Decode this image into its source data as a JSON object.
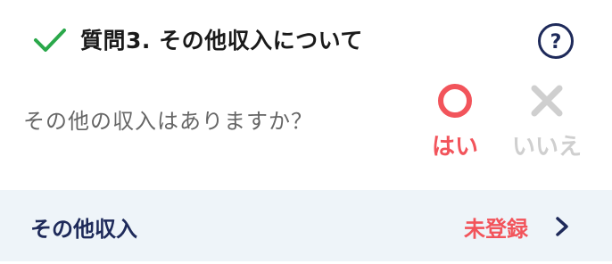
{
  "question_card": {
    "title": "質問3. その他収入について",
    "question_text": "その他の収入はありますか？",
    "options": [
      {
        "label": "はい",
        "icon": "circle-icon",
        "state": "selected"
      },
      {
        "label": "いいえ",
        "icon": "x-icon",
        "state": "unselected"
      }
    ],
    "icons": {
      "status": "check-icon",
      "help": "help-icon",
      "chevron": "chevron-right-icon"
    },
    "colors": {
      "accent_red": "#f2545b",
      "check_green": "#2aa84a",
      "navy": "#1e2a5a",
      "inactive_gray": "#cfcfcf",
      "footer_bg": "#eef4f9"
    }
  },
  "footer": {
    "label": "その他収入",
    "status": "未登録"
  }
}
